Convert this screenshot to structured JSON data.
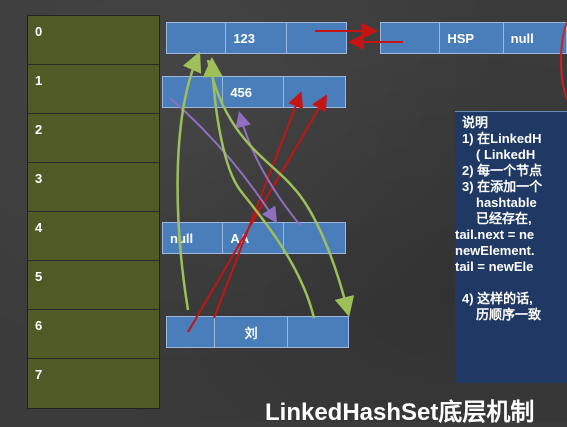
{
  "table": {
    "indices": [
      "0",
      "1",
      "2",
      "3",
      "4",
      "5",
      "6",
      "7"
    ]
  },
  "nodes": {
    "row0": [
      "",
      "123",
      ""
    ],
    "row0_next": [
      "",
      "HSP",
      "null"
    ],
    "row1": [
      "",
      "456",
      ""
    ],
    "row4": [
      "null",
      "AA",
      ""
    ],
    "row6": [
      "",
      "刘",
      ""
    ]
  },
  "note": {
    "title": "说明",
    "lines": [
      "1)  在LinkedH",
      "( LinkedH",
      "2)  每一个节点",
      "3)  在添加一个",
      "hashtable",
      "已经存在,",
      "tail.next = ne",
      "newElement.",
      "tail = newEle",
      "",
      "4)  这样的话,",
      "历顺序一致"
    ]
  },
  "footer_title": "LinkedHashSet底层机制",
  "colors": {
    "board": "#3b3b3b",
    "table": "#4f5a26",
    "node": "#4a7ebb",
    "note": "#1f3864",
    "red_arrow": "#c41414",
    "green_arrow": "#9fbf5a",
    "purple_arrow": "#8e6fc0"
  }
}
